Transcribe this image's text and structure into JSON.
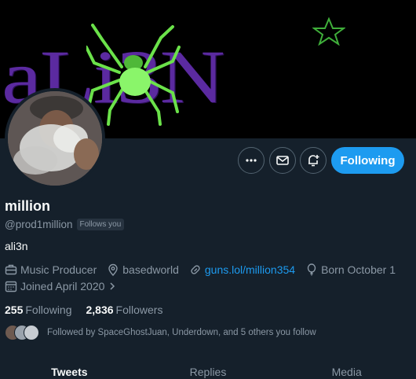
{
  "banner": {
    "text": "aLi3N"
  },
  "actions": {
    "more_icon": "more-horizontal-icon",
    "message_icon": "mail-icon",
    "notify_icon": "bell-plus-icon",
    "follow_label": "Following"
  },
  "profile": {
    "display_name": "million",
    "handle": "@prod1million",
    "follows_you": "Follows you",
    "bio": "ali3n",
    "category": "Music Producer",
    "location": "basedworld",
    "website": "guns.lol/million354",
    "birthday": "Born October 1",
    "joined": "Joined April 2020"
  },
  "stats": {
    "following_count": "255",
    "following_label": "Following",
    "followers_count": "2,836",
    "followers_label": "Followers"
  },
  "followed_by": {
    "text": "Followed by SpaceGhostJuan, Underdown, and 5 others you follow"
  },
  "tabs": [
    {
      "label": "Tweets"
    },
    {
      "label": "Replies"
    },
    {
      "label": "Media"
    }
  ],
  "colors": {
    "background": "#15202b",
    "accent": "#1d9bf0",
    "banner_text": "#5b2aa0",
    "spider": "#7cf05a",
    "muted": "#8b98a5"
  }
}
